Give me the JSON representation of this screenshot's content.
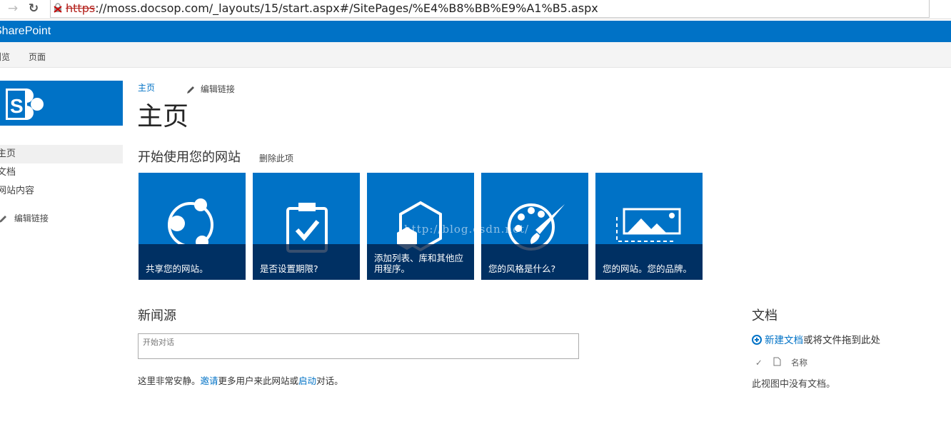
{
  "browser": {
    "url_scheme": "https",
    "url_rest": "://moss.docsop.com/_layouts/15/start.aspx#/SitePages/%E4%B8%BB%E9%A1%B5.aspx",
    "back_icon": "arrow-right-icon",
    "reload_icon": "reload-icon"
  },
  "suite": {
    "brand": "SharePoint"
  },
  "ribbon": {
    "tabs": [
      "浏览",
      "页面"
    ]
  },
  "quicklaunch": {
    "items": [
      "主页",
      "文档",
      "网站内容"
    ],
    "edit_links": "编辑链接"
  },
  "main": {
    "breadcrumb": "主页",
    "edit_links": "编辑链接",
    "page_title": "主页",
    "getting_started": {
      "heading": "开始使用您的网站",
      "remove": "删除此项",
      "tiles": [
        {
          "label": "共享您的网站。",
          "icon": "share-icon"
        },
        {
          "label": "是否设置期限?",
          "icon": "clipboard-check-icon"
        },
        {
          "label": "添加列表、库和其他应用程序。",
          "icon": "hexagon-apps-icon"
        },
        {
          "label": "您的风格是什么?",
          "icon": "palette-icon"
        },
        {
          "label": "您的网站。您的品牌。",
          "icon": "picture-icon"
        }
      ],
      "watermark": "http://blog.csdn.net/"
    },
    "newsfeed": {
      "heading": "新闻源",
      "placeholder": "开始对话",
      "note_pre": "这里非常安静。",
      "note_invite": "邀请",
      "note_mid": "更多用户来此网站或",
      "note_start": "启动",
      "note_post": "对话。"
    },
    "documents": {
      "heading": "文档",
      "new_link": "新建文档",
      "new_rest": "或将文件拖到此处",
      "col_name": "名称",
      "empty": "此视图中没有文档。"
    }
  },
  "colors": {
    "accent": "#0072c6",
    "tile_overlay": "#0a2a4a"
  }
}
